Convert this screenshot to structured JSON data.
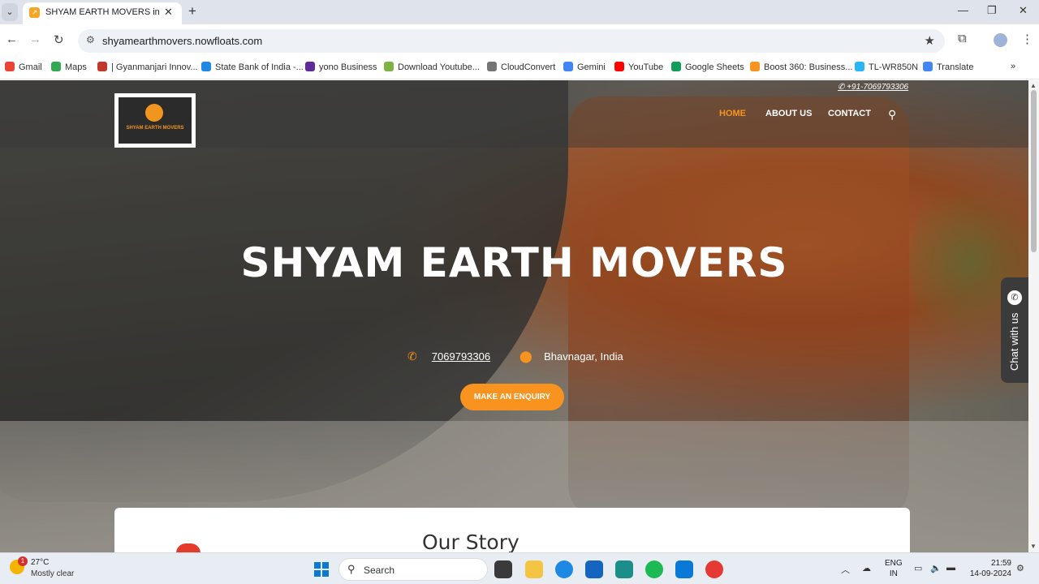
{
  "browser": {
    "tab_title": "SHYAM EARTH MOVERS in Bha",
    "url": "shyamearthmovers.nowfloats.com",
    "bookmarks": [
      {
        "label": "Gmail",
        "color": "#ea4335"
      },
      {
        "label": "Maps",
        "color": "#34a853"
      },
      {
        "label": "| Gyanmanjari Innov...",
        "color": "#c0392b"
      },
      {
        "label": "State Bank of India -...",
        "color": "#1e88e5"
      },
      {
        "label": "yono Business",
        "color": "#5e2b97"
      },
      {
        "label": "Download Youtube...",
        "color": "#7cb342"
      },
      {
        "label": "CloudConvert",
        "color": "#757575"
      },
      {
        "label": "Gemini",
        "color": "#4285f4"
      },
      {
        "label": "YouTube",
        "color": "#ff0000"
      },
      {
        "label": "Google Sheets",
        "color": "#0f9d58"
      },
      {
        "label": "Boost 360: Business...",
        "color": "#f7931e"
      },
      {
        "label": "TL-WR850N",
        "color": "#29b6f6"
      },
      {
        "label": "Translate",
        "color": "#4285f4"
      }
    ]
  },
  "site": {
    "phone_top": "+91-7069793306",
    "logo_text": "SHYAM EARTH MOVERS",
    "nav": [
      {
        "label": "HOME",
        "active": true
      },
      {
        "label": "ABOUT US",
        "active": false
      },
      {
        "label": "CONTACT",
        "active": false
      }
    ],
    "hero_title": "SHYAM EARTH MOVERS",
    "phone": "7069793306",
    "location": "Bhavnagar, India",
    "enquiry_label": "MAKE AN ENQUIRY",
    "story_title": "Our Story",
    "chat_label": "Chat with us",
    "accent_color": "#f7931e"
  },
  "taskbar": {
    "weather_temp": "27°C",
    "weather_cond": "Mostly clear",
    "weather_badge": "1",
    "search_label": "Search",
    "lang_line1": "ENG",
    "lang_line2": "IN",
    "time": "21:59",
    "date": "14-09-2024"
  }
}
